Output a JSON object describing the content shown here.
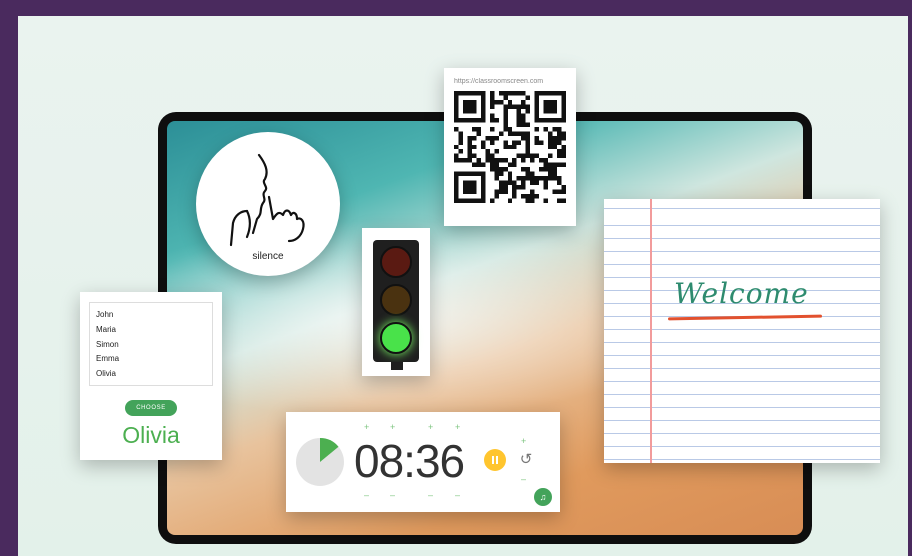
{
  "silence": {
    "label": "silence",
    "icon": "silence-gesture-icon"
  },
  "qr": {
    "url": "https://classroomscreen.com",
    "icon": "qr-code-icon"
  },
  "traffic_light": {
    "active": "green",
    "colors": {
      "red": "#5a1a12",
      "amber": "#4a3210",
      "green": "#49e24a"
    }
  },
  "picker": {
    "names": [
      "John",
      "Maria",
      "Simon",
      "Emma",
      "Olivia"
    ],
    "choose_label": "CHOOSE",
    "chosen": "Olivia"
  },
  "timer": {
    "time": "08:36",
    "plus": "+",
    "minus": "–",
    "pause_icon": "pause-icon",
    "reset_icon": "reset-icon",
    "reset_glyph": "↺",
    "music_icon": "music-note-icon",
    "music_glyph": "♫",
    "progress": 0.14
  },
  "note": {
    "text": "Welcome",
    "accent": "#2e8b6f",
    "underline": "#e2512e"
  },
  "colors": {
    "accent_green": "#43a35a",
    "background": "#e3f1ea"
  }
}
